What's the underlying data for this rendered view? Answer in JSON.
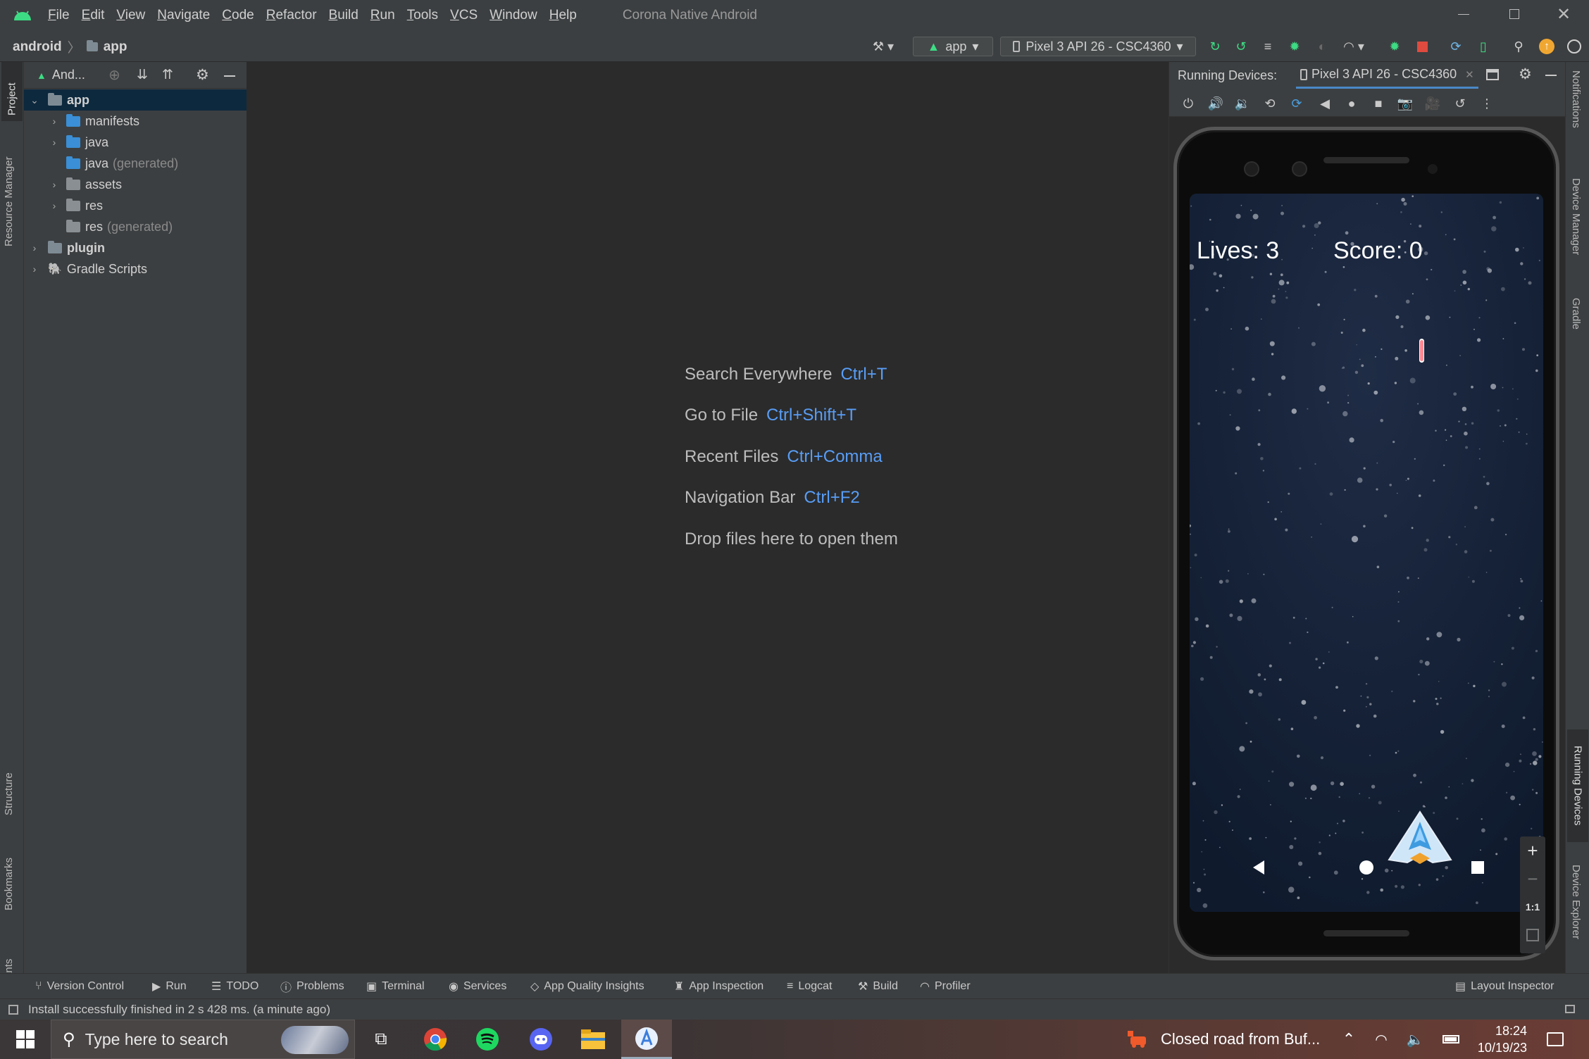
{
  "menu": [
    "File",
    "Edit",
    "View",
    "Navigate",
    "Code",
    "Refactor",
    "Build",
    "Run",
    "Tools",
    "VCS",
    "Window",
    "Help"
  ],
  "window_title": "Corona Native Android",
  "breadcrumb": {
    "root": "android",
    "module": "app"
  },
  "toolbar": {
    "run_config": "app",
    "device": "Pixel 3 API 26 - CSC4360"
  },
  "left_tabs": {
    "project": "Project",
    "resource_manager": "Resource Manager",
    "structure": "Structure",
    "bookmarks": "Bookmarks",
    "build_variants": "Build Variants"
  },
  "right_tabs": {
    "notifications": "Notifications",
    "device_manager": "Device Manager",
    "gradle": "Gradle",
    "running_devices": "Running Devices",
    "device_explorer": "Device Explorer"
  },
  "project_panel": {
    "view_name": "And...",
    "tree": [
      {
        "label": "app",
        "suffix": ""
      },
      {
        "label": "manifests",
        "suffix": ""
      },
      {
        "label": "java",
        "suffix": ""
      },
      {
        "label": "java",
        "suffix": "(generated)"
      },
      {
        "label": "assets",
        "suffix": ""
      },
      {
        "label": "res",
        "suffix": ""
      },
      {
        "label": "res",
        "suffix": "(generated)"
      },
      {
        "label": "plugin",
        "suffix": ""
      },
      {
        "label": "Gradle Scripts",
        "suffix": ""
      }
    ]
  },
  "editor_hints": [
    {
      "text": "Search Everywhere",
      "key": "Ctrl+T"
    },
    {
      "text": "Go to File",
      "key": "Ctrl+Shift+T"
    },
    {
      "text": "Recent Files",
      "key": "Ctrl+Comma"
    },
    {
      "text": "Navigation Bar",
      "key": "Ctrl+F2"
    },
    {
      "text": "Drop files here to open them",
      "key": ""
    }
  ],
  "running_devices": {
    "label": "Running Devices:",
    "tab": "Pixel 3 API 26 - CSC4360",
    "zoom_reset": "1:1",
    "game": {
      "lives": "Lives: 3",
      "score": "Score: 0"
    }
  },
  "bottom_tools": [
    "Version Control",
    "Run",
    "TODO",
    "Problems",
    "Terminal",
    "Services",
    "App Quality Insights",
    "App Inspection",
    "Logcat",
    "Build",
    "Profiler"
  ],
  "layout_inspector": "Layout Inspector",
  "status_message": "Install successfully finished in 2 s 428 ms. (a minute ago)",
  "taskbar": {
    "search_placeholder": "Type here to search",
    "notification": "Closed road from Buf...",
    "time": "18:24",
    "date": "10/19/23"
  },
  "colors": {
    "accent_blue": "#589df6",
    "android_green": "#3ddc84",
    "stop_red": "#e04b3f",
    "selection": "#0d293e"
  }
}
